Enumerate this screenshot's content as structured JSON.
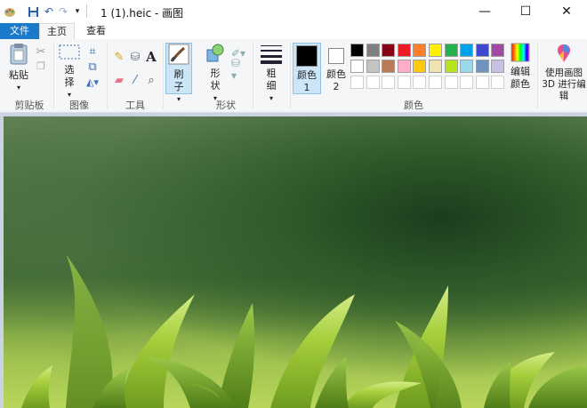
{
  "window": {
    "title": "1 (1).heic - 画图",
    "minimize": "—",
    "maximize": "☐",
    "close": "✕"
  },
  "quick_access": {
    "dropdown": "▾"
  },
  "tabs": {
    "file": "文件",
    "home": "主页",
    "view": "查看"
  },
  "clipboard": {
    "paste": "粘贴",
    "group": "剪贴板"
  },
  "image_group": {
    "select": "选择",
    "group": "图像"
  },
  "tools": {
    "group": "工具"
  },
  "brush": {
    "label": "刷子"
  },
  "shapes": {
    "label": "形状",
    "group": "形状"
  },
  "size": {
    "label": "粗细"
  },
  "colors": {
    "color1": "颜色 1",
    "color2": "颜色 2",
    "group": "颜色",
    "edit": "编辑颜色",
    "paint3d": "使用画图 3D 进行编辑",
    "color1_value": "#000000",
    "color2_value": "#ffffff",
    "palette_row1": [
      "#000000",
      "#7f7f7f",
      "#880015",
      "#ed1c24",
      "#ff7f27",
      "#fff200",
      "#22b14c",
      "#00a2e8",
      "#3f48cc",
      "#a349a4"
    ],
    "palette_row2": [
      "#ffffff",
      "#c3c3c3",
      "#b97a57",
      "#ffaec9",
      "#ffc90e",
      "#efe4b0",
      "#b5e61d",
      "#99d9ea",
      "#7092be",
      "#c8bfe7"
    ]
  }
}
